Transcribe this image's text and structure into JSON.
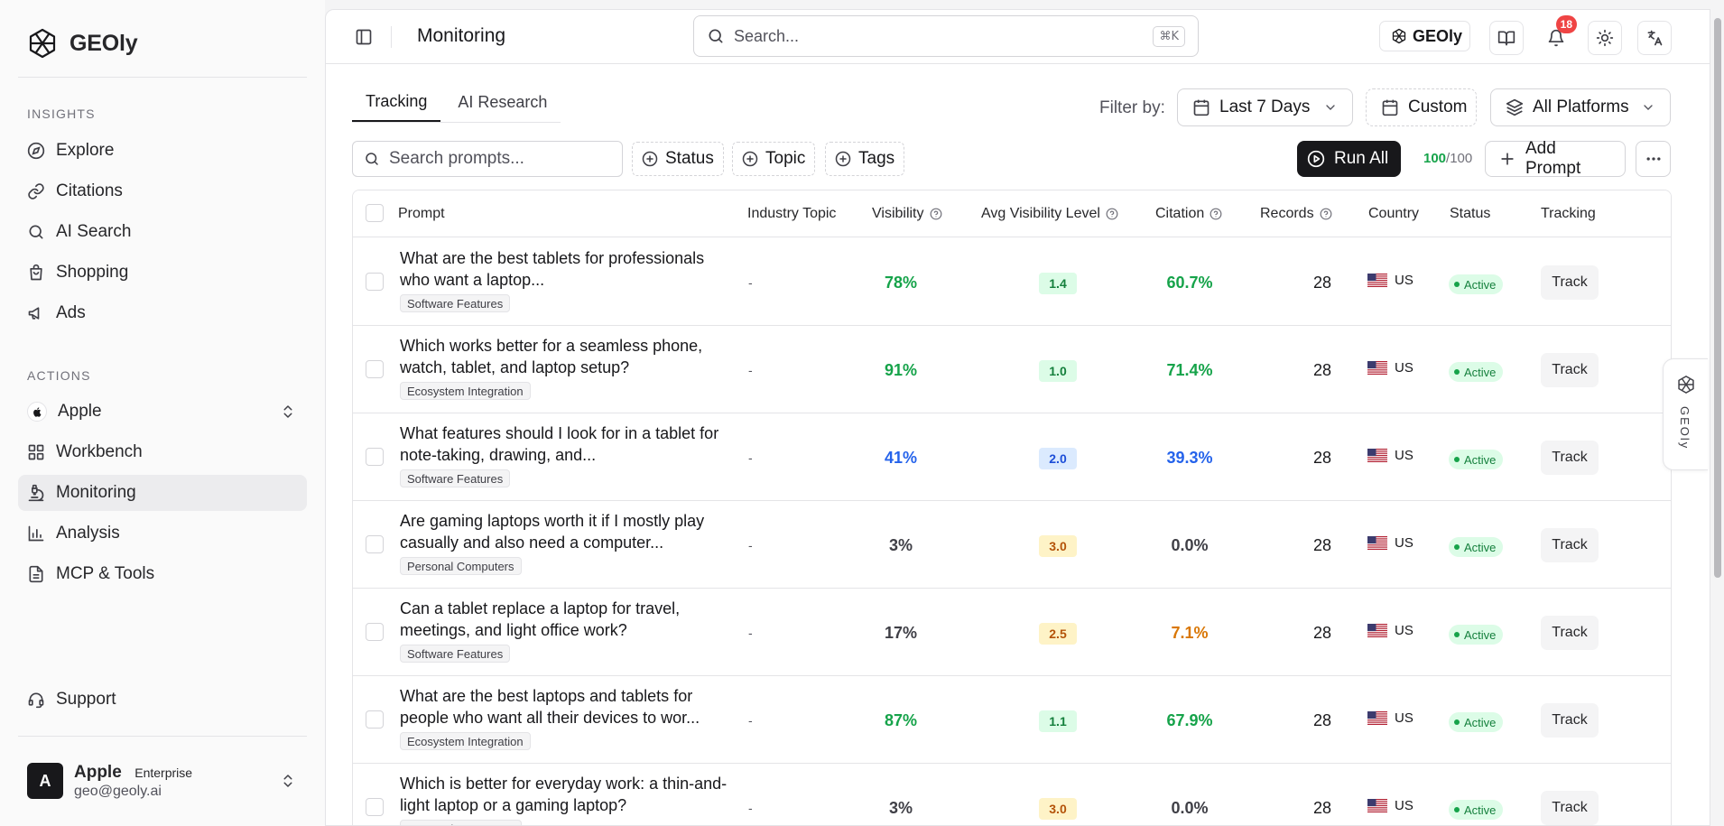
{
  "app": {
    "brand": "GEOly"
  },
  "sidebar": {
    "insights_label": "INSIGHTS",
    "insights": [
      {
        "label": "Explore",
        "icon": "compass-icon"
      },
      {
        "label": "Citations",
        "icon": "link-icon"
      },
      {
        "label": "AI Search",
        "icon": "search-icon"
      },
      {
        "label": "Shopping",
        "icon": "shopping-bag-icon"
      },
      {
        "label": "Ads",
        "icon": "megaphone-icon"
      }
    ],
    "actions_label": "ACTIONS",
    "brand_selector": "Apple",
    "actions": [
      {
        "label": "Workbench",
        "icon": "layout-grid-icon"
      },
      {
        "label": "Monitoring",
        "icon": "microscope-icon",
        "active": true
      },
      {
        "label": "Analysis",
        "icon": "bar-chart-icon"
      },
      {
        "label": "MCP & Tools",
        "icon": "document-icon"
      }
    ],
    "support": "Support",
    "user": {
      "avatar": "A",
      "name": "Apple",
      "plan": "Enterprise",
      "email": "geo@geoly.ai"
    }
  },
  "header": {
    "title": "Monitoring",
    "search_placeholder": "Search...",
    "shortcut": "⌘K",
    "geoly_button": "GEOly",
    "notification_count": "18"
  },
  "tabs": [
    "Tracking",
    "AI Research"
  ],
  "filters": {
    "label": "Filter by:",
    "date_range": "Last 7 Days",
    "custom": "Custom",
    "platforms": "All Platforms"
  },
  "toolbar": {
    "search_placeholder": "Search prompts...",
    "chips": [
      "Status",
      "Topic",
      "Tags"
    ],
    "run_all": "Run All",
    "quota_used": "100",
    "quota_total": "/100",
    "add_prompt": "Add Prompt"
  },
  "table": {
    "columns": {
      "prompt": "Prompt",
      "industry_topic": "Industry Topic",
      "visibility": "Visibility",
      "avg_visibility_level": "Avg Visibility Level",
      "citation": "Citation",
      "records": "Records",
      "country": "Country",
      "status": "Status",
      "tracking": "Tracking"
    },
    "rows": [
      {
        "prompt": "What are the best tablets for professionals who want a laptop...",
        "tag": "Software Features",
        "industry_topic": "-",
        "visibility": "78%",
        "avg_level": "1.4",
        "citation": "60.7%",
        "records": "28",
        "country": "US",
        "status": "Active",
        "tracking": "Track",
        "vis_color": "green",
        "lvl_color": "green",
        "cit_color": "green"
      },
      {
        "prompt": "Which works better for a seamless phone, watch, tablet, and laptop setup?",
        "tag": "Ecosystem Integration",
        "industry_topic": "-",
        "visibility": "91%",
        "avg_level": "1.0",
        "citation": "71.4%",
        "records": "28",
        "country": "US",
        "status": "Active",
        "tracking": "Track",
        "vis_color": "green",
        "lvl_color": "green",
        "cit_color": "green"
      },
      {
        "prompt": "What features should I look for in a tablet for note-taking, drawing, and...",
        "tag": "Software Features",
        "industry_topic": "-",
        "visibility": "41%",
        "avg_level": "2.0",
        "citation": "39.3%",
        "records": "28",
        "country": "US",
        "status": "Active",
        "tracking": "Track",
        "vis_color": "blue",
        "lvl_color": "blue",
        "cit_color": "blue"
      },
      {
        "prompt": "Are gaming laptops worth it if I mostly play casually and also need a computer...",
        "tag": "Personal Computers",
        "industry_topic": "-",
        "visibility": "3%",
        "avg_level": "3.0",
        "citation": "0.0%",
        "records": "28",
        "country": "US",
        "status": "Active",
        "tracking": "Track",
        "vis_color": "gray",
        "lvl_color": "yellow",
        "cit_color": "gray"
      },
      {
        "prompt": "Can a tablet replace a laptop for travel, meetings, and light office work?",
        "tag": "Software Features",
        "industry_topic": "-",
        "visibility": "17%",
        "avg_level": "2.5",
        "citation": "7.1%",
        "records": "28",
        "country": "US",
        "status": "Active",
        "tracking": "Track",
        "vis_color": "gray",
        "lvl_color": "yellow",
        "cit_color": "orange"
      },
      {
        "prompt": "What are the best laptops and tablets for people who want all their devices to wor...",
        "tag": "Ecosystem Integration",
        "industry_topic": "-",
        "visibility": "87%",
        "avg_level": "1.1",
        "citation": "67.9%",
        "records": "28",
        "country": "US",
        "status": "Active",
        "tracking": "Track",
        "vis_color": "green",
        "lvl_color": "green",
        "cit_color": "green"
      },
      {
        "prompt": "Which is better for everyday work: a thin-and-light laptop or a gaming laptop?",
        "tag": "Personal Computers",
        "industry_topic": "-",
        "visibility": "3%",
        "avg_level": "3.0",
        "citation": "0.0%",
        "records": "28",
        "country": "US",
        "status": "Active",
        "tracking": "Track",
        "vis_color": "gray",
        "lvl_color": "yellow",
        "cit_color": "gray"
      }
    ]
  },
  "floating_tab": {
    "label": "GEOly"
  }
}
